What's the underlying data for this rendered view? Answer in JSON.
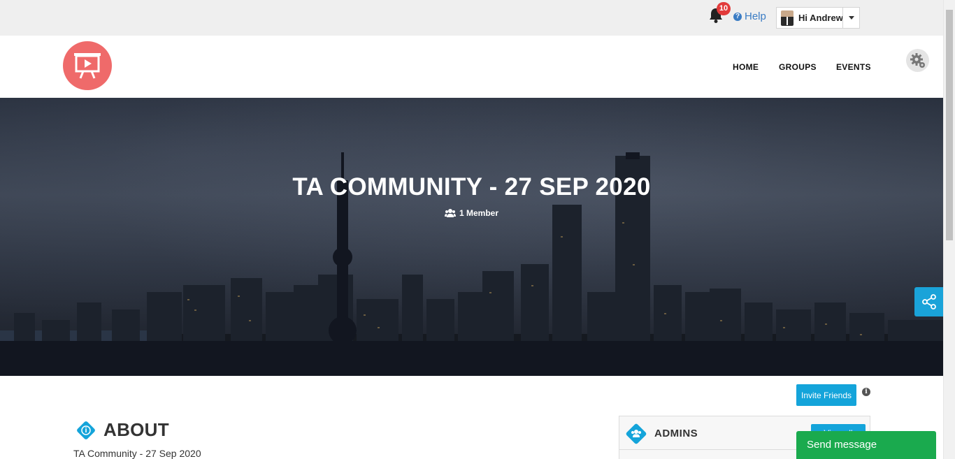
{
  "topbar": {
    "notification_count": "10",
    "help_label": "Help",
    "user_greeting": "Hi Andrew"
  },
  "nav": {
    "home": "HOME",
    "groups": "GROUPS",
    "events": "EVENTS"
  },
  "hero": {
    "title": "TA COMMUNITY - 27 SEP 2020",
    "members": "1 Member"
  },
  "actions": {
    "invite_label": "Invite Friends"
  },
  "about": {
    "title": "ABOUT",
    "text": "TA Community - 27 Sep 2020"
  },
  "admins": {
    "title": "ADMINS",
    "view_all_label": "View all"
  },
  "chat": {
    "send_message_label": "Send message"
  },
  "colors": {
    "accent": "#14a4da",
    "logo": "#ef6a6a",
    "send_button": "#1aaa4e",
    "badge": "#e23b3b",
    "help_link": "#3a7cc4"
  },
  "icons": [
    "bell-icon",
    "help-icon",
    "avatar",
    "caret-down-icon",
    "presentation-icon",
    "gear-icon",
    "users-icon",
    "share-icon",
    "info-icon"
  ]
}
